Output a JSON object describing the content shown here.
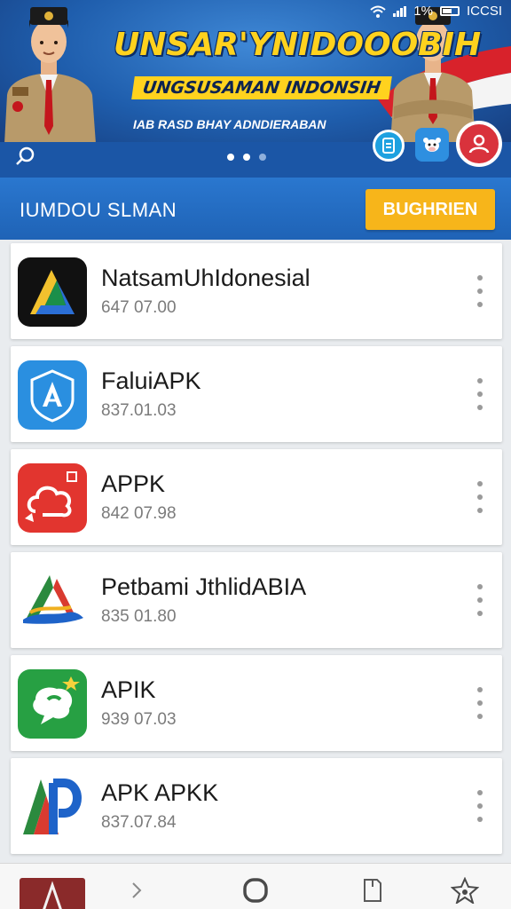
{
  "status_bar": {
    "text1": "1%",
    "text2": "ICCSI"
  },
  "banner": {
    "title": "UNSAR'YNIDOOOBIH",
    "subtitle": "UNGSUSAMAN INDONSIH",
    "tagline": "IAB RASD BHAY ADNDIERABAN",
    "dots": 3,
    "active_dot": 1
  },
  "section": {
    "title": "IUMDOU SLMAN",
    "button_label": "BUGHRIEN"
  },
  "apps": [
    {
      "name": "NatsamUhIdonesial",
      "date": "647 07.00",
      "icon": "triangle-logo-icon"
    },
    {
      "name": "FaluiAPK",
      "date": "837.01.03",
      "icon": "shield-a-icon"
    },
    {
      "name": "APPK",
      "date": "842 07.98",
      "icon": "red-cloud-icon"
    },
    {
      "name": "Petbami JthlidABIA",
      "date": "835 01.80",
      "icon": "wave-triangle-icon"
    },
    {
      "name": "APIK",
      "date": "939 07.03",
      "icon": "chat-bubble-icon"
    },
    {
      "name": "APK APKK",
      "date": "837.07.84",
      "icon": "ap-logo-icon"
    }
  ],
  "colors": {
    "banner_blue": "#1d5fae",
    "section_blue": "#2a77cf",
    "accent_yellow": "#f7b51a",
    "card_bg": "#ffffff"
  }
}
